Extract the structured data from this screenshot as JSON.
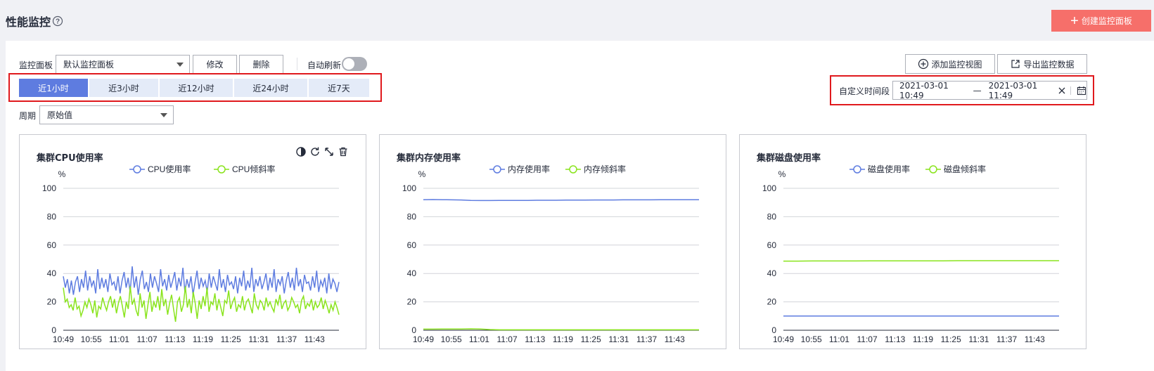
{
  "header": {
    "title": "性能监控",
    "create_label": "创建监控面板"
  },
  "toolbar": {
    "panel_label": "监控面板",
    "panel_value": "默认监控面板",
    "edit_label": "修改",
    "delete_label": "删除",
    "auto_refresh_label": "自动刷新",
    "auto_refresh_on": false,
    "add_view_label": "添加监控视图",
    "export_label": "导出监控数据"
  },
  "time_tabs": [
    {
      "label": "近1小时",
      "active": true
    },
    {
      "label": "近3小时",
      "active": false
    },
    {
      "label": "近12小时",
      "active": false
    },
    {
      "label": "近24小时",
      "active": false
    },
    {
      "label": "近7天",
      "active": false
    }
  ],
  "custom_range": {
    "label": "自定义时间段",
    "start": "2021-03-01 10:49",
    "separator": "—",
    "end": "2021-03-01 11:49"
  },
  "period": {
    "label": "周期",
    "value": "原始值"
  },
  "colors": {
    "blue_series": "#5e7ce0",
    "green_series": "#8ae41d",
    "accent": "#5e7ce0",
    "create_button": "#f66f6a",
    "highlight_box": "#e0191d"
  },
  "chart_data": [
    {
      "type": "line",
      "title": "集群CPU使用率",
      "ylabel": "%",
      "ylim": [
        0,
        100
      ],
      "yticks": [
        "100",
        "80",
        "60",
        "40",
        "20",
        "0"
      ],
      "x_tick_labels": [
        "10:49",
        "10:55",
        "11:01",
        "11:07",
        "11:13",
        "11:19",
        "11:25",
        "11:31",
        "11:37",
        "11:43"
      ],
      "grid": true,
      "legend": "top",
      "series": [
        {
          "name": "CPU使用率",
          "color": "#5e7ce0",
          "values": [
            38,
            30,
            36,
            26,
            35,
            25,
            34,
            38,
            27,
            36,
            30,
            42,
            28,
            38,
            31,
            35,
            26,
            43,
            29,
            37,
            30,
            36,
            27,
            40,
            32,
            34,
            28,
            38,
            26,
            35,
            41,
            30,
            37,
            27,
            45,
            30,
            38,
            25,
            36,
            42,
            29,
            34,
            27,
            40,
            30,
            38,
            33,
            27,
            43,
            31,
            36,
            28,
            39,
            30,
            35,
            41,
            28,
            37,
            31,
            44,
            27,
            36,
            30,
            38,
            25,
            34,
            42,
            29,
            37,
            31,
            35,
            27,
            40,
            30,
            38,
            33,
            28,
            43,
            30,
            36,
            27,
            39,
            32,
            34,
            29,
            38,
            26,
            37,
            31,
            42,
            28,
            35,
            30,
            44,
            27,
            36,
            31,
            38,
            29,
            34,
            40,
            28,
            37,
            30,
            43,
            27,
            36,
            32,
            38,
            26,
            35,
            41,
            30,
            37,
            28,
            44,
            31,
            36,
            27,
            39,
            33,
            34,
            28,
            38,
            30,
            42,
            27,
            35,
            31,
            37,
            26,
            40,
            29,
            36,
            33,
            27,
            34
          ]
        },
        {
          "name": "CPU倾斜率",
          "color": "#8ae41d",
          "values": [
            30,
            20,
            22,
            16,
            18,
            14,
            23,
            15,
            17,
            10,
            14,
            20,
            16,
            22,
            18,
            12,
            21,
            9,
            17,
            15,
            23,
            18,
            14,
            20,
            24,
            16,
            22,
            12,
            19,
            24,
            17,
            9,
            20,
            15,
            31,
            18,
            22,
            14,
            10,
            26,
            16,
            21,
            8,
            18,
            27,
            13,
            20,
            16,
            24,
            14,
            29,
            17,
            22,
            11,
            19,
            25,
            15,
            6,
            20,
            23,
            13,
            18,
            31,
            16,
            22,
            12,
            27,
            19,
            8,
            21,
            15,
            24,
            17,
            30,
            13,
            20,
            18,
            26,
            14,
            22,
            16,
            10,
            21,
            19,
            28,
            15,
            20,
            23,
            13,
            18,
            16,
            24,
            14,
            20,
            22,
            17,
            12,
            26,
            18,
            15,
            21,
            19,
            14,
            23,
            17,
            20,
            16,
            13,
            22,
            18,
            25,
            15,
            19,
            21,
            14,
            17,
            23,
            20,
            16,
            18,
            12,
            21,
            24,
            15,
            19,
            17,
            22,
            14,
            20,
            16,
            18,
            23,
            15,
            21,
            17,
            12,
            18,
            14,
            20,
            16,
            11
          ]
        }
      ]
    },
    {
      "type": "line",
      "title": "集群内存使用率",
      "ylabel": "%",
      "ylim": [
        0,
        100
      ],
      "yticks": [
        "100",
        "80",
        "60",
        "40",
        "20",
        "0"
      ],
      "x_tick_labels": [
        "10:49",
        "10:55",
        "11:01",
        "11:07",
        "11:13",
        "11:19",
        "11:25",
        "11:31",
        "11:37",
        "11:43"
      ],
      "grid": true,
      "legend": "top",
      "series": [
        {
          "name": "内存使用率",
          "color": "#5e7ce0",
          "values": [
            92.0,
            92.1,
            92.0,
            91.9,
            91.8,
            91.5,
            91.4,
            91.4,
            91.5,
            91.5,
            91.5,
            91.5,
            91.6,
            91.6,
            91.6,
            91.7,
            91.7,
            91.7,
            91.8,
            91.8,
            91.8,
            91.9,
            91.9,
            91.9,
            91.9,
            92.0,
            92.0,
            92.0,
            92.0,
            92.0
          ]
        },
        {
          "name": "内存倾斜率",
          "color": "#8ae41d",
          "values": [
            0.8,
            0.8,
            0.9,
            0.9,
            0.9,
            1.0,
            0.9,
            0.5,
            0.3,
            0.3,
            0.3,
            0.3,
            0.3,
            0.3,
            0.3,
            0.3,
            0.3,
            0.3,
            0.3,
            0.3,
            0.3,
            0.3,
            0.3,
            0.3,
            0.3,
            0.3,
            0.3,
            0.3,
            0.3,
            0.3
          ]
        }
      ]
    },
    {
      "type": "line",
      "title": "集群磁盘使用率",
      "ylabel": "%",
      "ylim": [
        0,
        100
      ],
      "yticks": [
        "100",
        "80",
        "60",
        "40",
        "20",
        "0"
      ],
      "x_tick_labels": [
        "10:49",
        "10:55",
        "11:01",
        "11:07",
        "11:13",
        "11:19",
        "11:25",
        "11:31",
        "11:37",
        "11:43"
      ],
      "grid": true,
      "legend": "top",
      "series": [
        {
          "name": "磁盘使用率",
          "color": "#5e7ce0",
          "values": [
            10,
            10,
            10,
            10,
            10,
            10,
            10,
            10,
            10,
            10,
            10,
            10,
            10,
            10,
            10,
            10,
            10,
            10,
            10,
            10
          ]
        },
        {
          "name": "磁盘倾斜率",
          "color": "#8ae41d",
          "values": [
            48.7,
            48.7,
            48.8,
            48.8,
            48.8,
            48.8,
            48.9,
            48.9,
            48.9,
            48.9,
            48.9,
            48.9,
            49.0,
            49.0,
            49.0,
            49.0,
            49.0,
            49.0,
            49.0,
            49.0
          ]
        }
      ]
    }
  ]
}
